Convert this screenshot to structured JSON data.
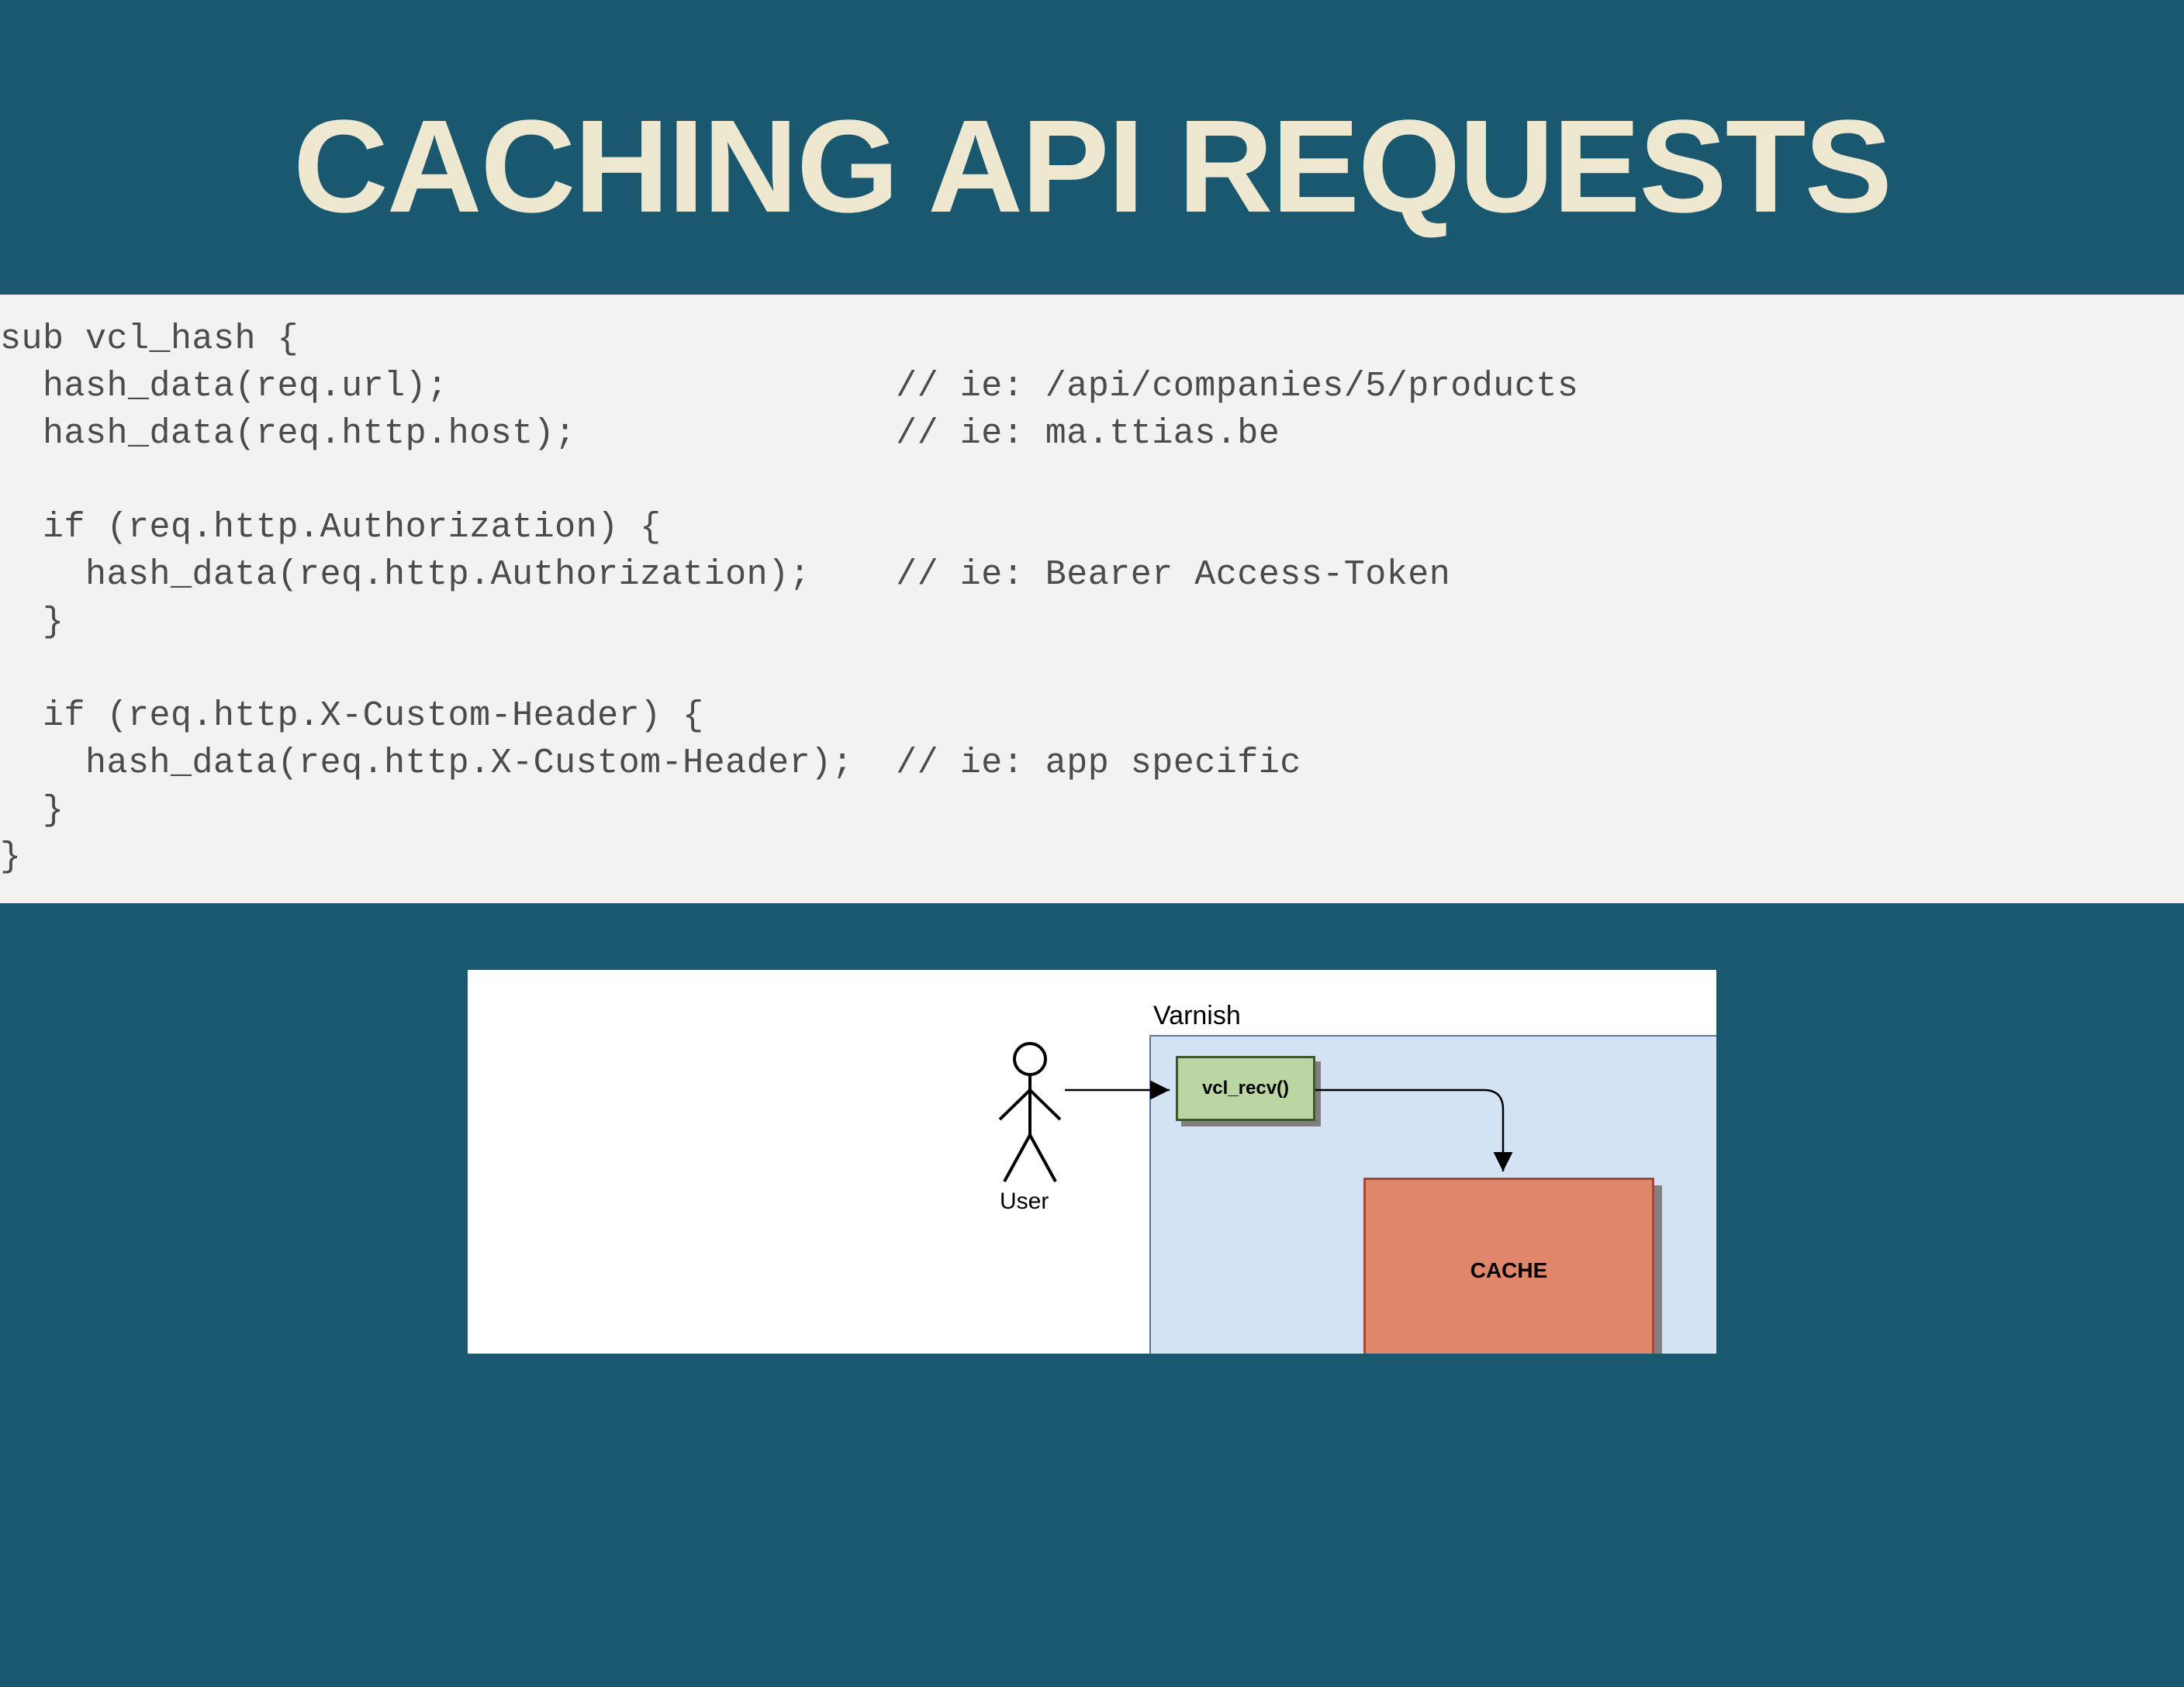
{
  "title": "CACHING API REQUESTS",
  "code": "sub vcl_hash {\n  hash_data(req.url);                     // ie: /api/companies/5/products\n  hash_data(req.http.host);               // ie: ma.ttias.be\n\n  if (req.http.Authorization) {\n    hash_data(req.http.Authorization);    // ie: Bearer Access-Token\n  }\n\n  if (req.http.X-Custom-Header) {\n    hash_data(req.http.X-Custom-Header);  // ie: app specific\n  }\n}",
  "diagram": {
    "container_label": "Varnish",
    "actor_label": "User",
    "recv_label": "vcl_recv()",
    "cache_label": "CACHE"
  },
  "colors": {
    "background": "#1a5870",
    "title_text": "#efe8d1",
    "code_bg": "#f2f2f1",
    "code_text": "#4b4b4b",
    "varnish_fill": "#d4e3f3",
    "recv_fill": "#bcd6a3",
    "cache_fill": "#e0866b"
  }
}
